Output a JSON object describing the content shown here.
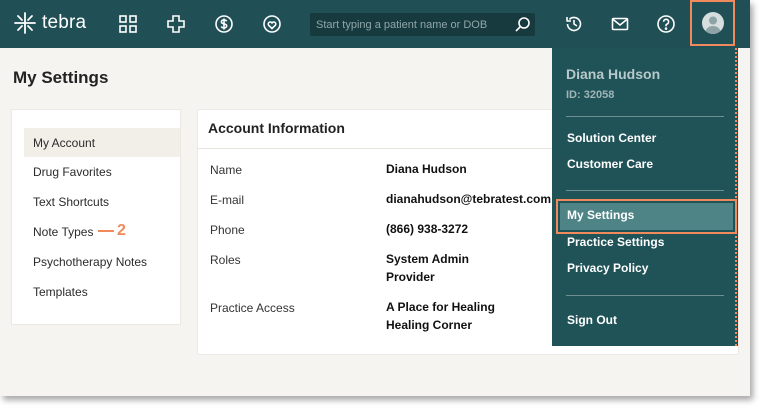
{
  "app": {
    "logo_text": "tebra",
    "search_placeholder": "Start typing a patient name or DOB",
    "nav_icons": [
      "grid-icon",
      "medical-cross-icon",
      "dollar-icon",
      "heart-shield-icon",
      "history-icon",
      "mail-icon",
      "help-icon",
      "user-avatar-icon"
    ]
  },
  "page": {
    "title": "My Settings"
  },
  "sidebar": {
    "items": [
      {
        "label": "My Account",
        "active": true
      },
      {
        "label": "Drug Favorites"
      },
      {
        "label": "Text Shortcuts"
      },
      {
        "label": "Note Types"
      },
      {
        "label": "Psychotherapy Notes"
      },
      {
        "label": "Templates"
      }
    ],
    "callout_number": "2"
  },
  "account": {
    "title": "Account Information",
    "rows": [
      {
        "label": "Name",
        "value": "Diana Hudson"
      },
      {
        "label": "E-mail",
        "value": "dianahudson@tebratest.com"
      },
      {
        "label": "Phone",
        "value": "(866) 938-3272"
      },
      {
        "label": "Roles",
        "values": [
          "System Admin",
          "Provider"
        ]
      },
      {
        "label": "Practice Access",
        "values": [
          "A Place for Healing",
          "Healing Corner"
        ]
      }
    ]
  },
  "user_menu": {
    "name": "Diana Hudson",
    "id": "ID: 32058",
    "group1": [
      "Solution Center",
      "Customer Care"
    ],
    "group2": [
      "My Settings",
      "Practice Settings",
      "Privacy Policy"
    ],
    "sign_out": "Sign Out"
  },
  "colors": {
    "topbar": "#204f55",
    "highlight": "#f08a5d",
    "menu_bg": "#1f5357"
  }
}
